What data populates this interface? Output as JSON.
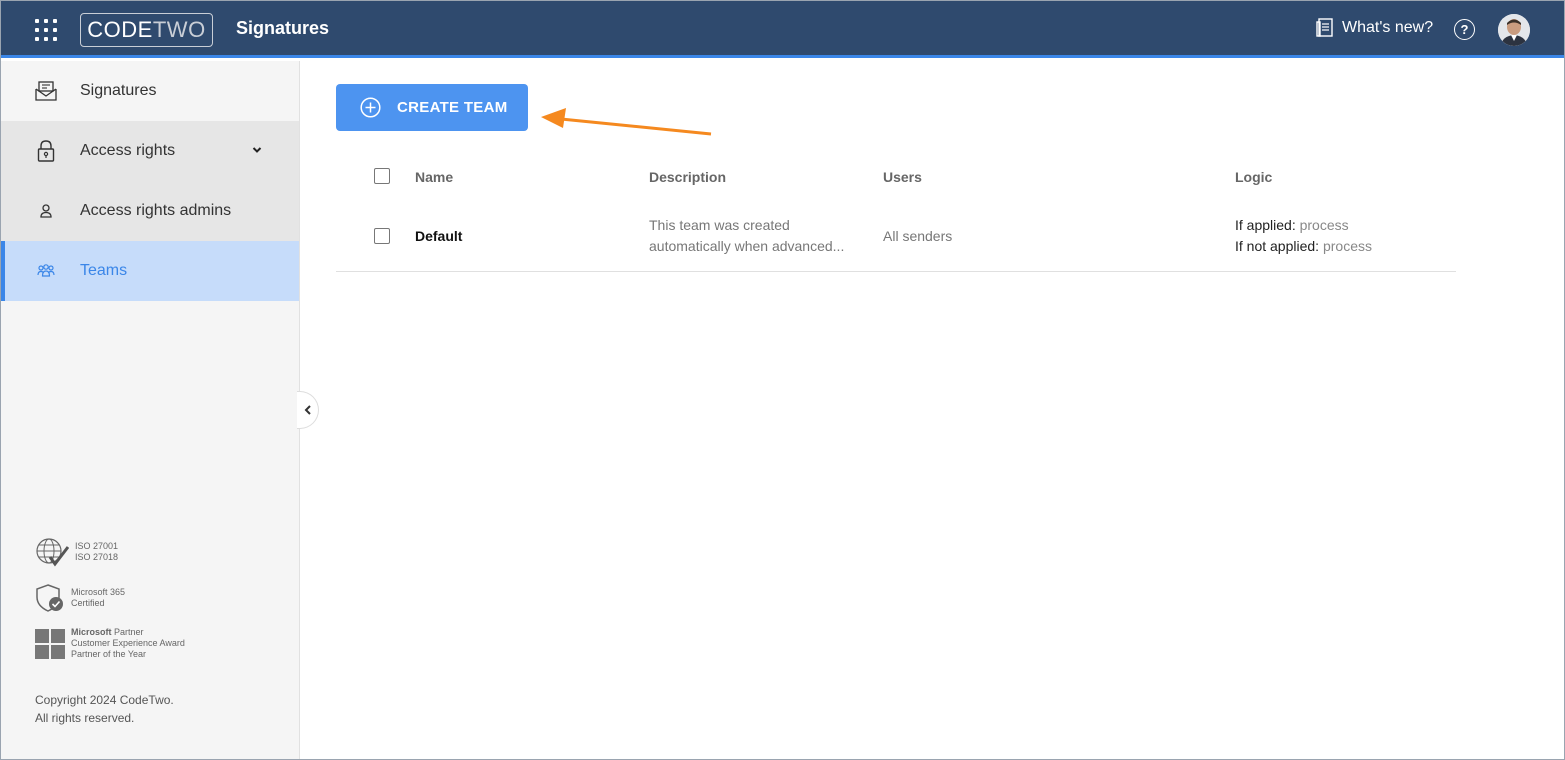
{
  "header": {
    "logo_code": "CODE",
    "logo_two": "TWO",
    "app_title": "Signatures",
    "whats_new": "What's new?",
    "help": "?"
  },
  "sidebar": {
    "items": [
      {
        "label": "Signatures",
        "icon": "signature-icon"
      },
      {
        "label": "Access rights",
        "icon": "lock-icon"
      },
      {
        "label": "Access rights admins",
        "icon": "person-icon"
      },
      {
        "label": "Teams",
        "icon": "team-icon"
      }
    ],
    "certs": [
      {
        "line1": "ISO 27001",
        "line2": "ISO 27018"
      },
      {
        "line1": "Microsoft 365",
        "line2": "Certified"
      },
      {
        "line1_bold": "Microsoft",
        "line1_rest": " Partner",
        "line2": "Customer Experience Award",
        "line3": "Partner of the Year"
      }
    ],
    "copyright_line1": "Copyright 2024 CodeTwo.",
    "copyright_line2": "All rights reserved."
  },
  "main": {
    "create_button": "CREATE TEAM",
    "columns": [
      "Name",
      "Description",
      "Users",
      "Logic"
    ],
    "rows": [
      {
        "name": "Default",
        "description_line1": "This team was created",
        "description_line2": "automatically when advanced...",
        "users": "All senders",
        "logic_applied_label": "If applied:",
        "logic_applied_value": "process",
        "logic_not_applied_label": "If not applied:",
        "logic_not_applied_value": "process"
      }
    ]
  },
  "colors": {
    "topbar": "#2f4a6e",
    "accent": "#3a86e8",
    "button": "#4d94f0",
    "annotation_arrow": "#f5891f"
  }
}
